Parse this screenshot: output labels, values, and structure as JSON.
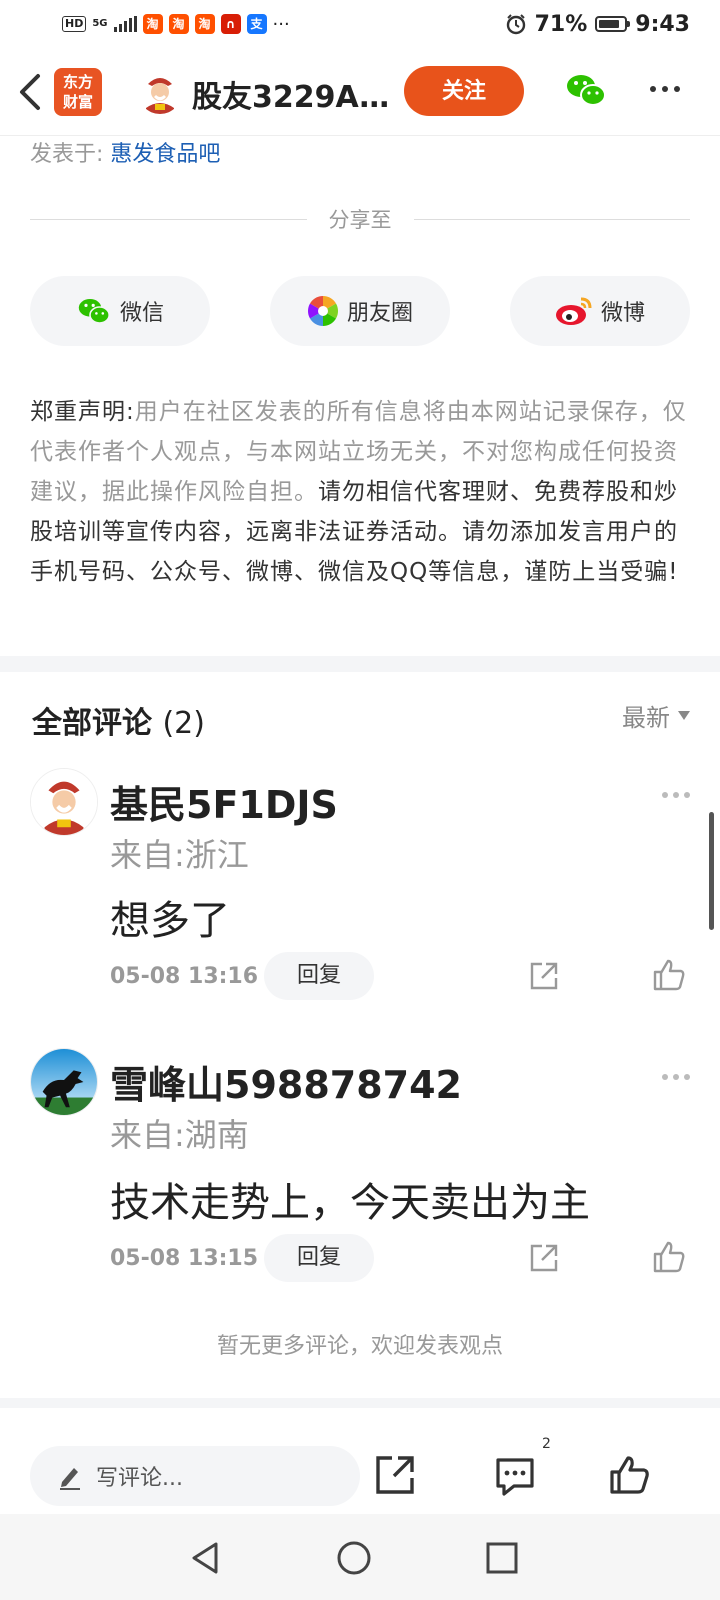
{
  "status_bar": {
    "hd": "HD",
    "network": "5G",
    "battery_pct": "71%",
    "time": "9:43",
    "app_icons": [
      {
        "name": "taobao-icon",
        "glyph": "淘",
        "color": "#ff5000"
      },
      {
        "name": "taobao-icon",
        "glyph": "淘",
        "color": "#ff5000"
      },
      {
        "name": "taobao-icon",
        "glyph": "淘",
        "color": "#ff5000"
      },
      {
        "name": "app-icon",
        "glyph": "∩",
        "color": "#d81e06"
      },
      {
        "name": "alipay-icon",
        "glyph": "支",
        "color": "#1677ff"
      }
    ],
    "more": "···"
  },
  "header": {
    "logo_line1": "东方",
    "logo_line2": "财富",
    "title": "股友3229A...",
    "follow_label": "关注"
  },
  "post": {
    "posted_in_label": "发表于:",
    "posted_in_link": "惠发食品吧"
  },
  "share": {
    "label": "分享至",
    "buttons": [
      {
        "label": "微信",
        "icon": "wechat-icon"
      },
      {
        "label": "朋友圈",
        "icon": "moments-icon"
      },
      {
        "label": "微博",
        "icon": "weibo-icon"
      }
    ]
  },
  "disclaimer": {
    "title": "郑重声明:",
    "body_light": "用户在社区发表的所有信息将由本网站记录保存，仅代表作者个人观点，与本网站立场无关，不对您构成任何投资建议，据此操作风险自担。",
    "body_strong": "请勿相信代客理财、免费荐股和炒股培训等宣传内容，远离非法证券活动。请勿添加发言用户的手机号码、公众号、微博、微信及QQ等信息，谨防上当受骗!"
  },
  "comments": {
    "title": "全部评论",
    "count": "(2)",
    "sort_label": "最新",
    "items": [
      {
        "author": "基民5F1DJS",
        "location": "来自:浙江",
        "text": "想多了",
        "time": "05-08 13:16",
        "reply_label": "回复"
      },
      {
        "author": "雪峰山598878742",
        "location": "来自:湖南",
        "text": "技术走势上，今天卖出为主",
        "time": "05-08 13:15",
        "reply_label": "回复"
      }
    ],
    "no_more": "暂无更多评论，欢迎发表观点"
  },
  "bottom_bar": {
    "write_placeholder": "写评论...",
    "comment_badge": "2"
  },
  "colors": {
    "accent": "#e8531b",
    "link": "#1d5fb4",
    "muted": "#999999"
  }
}
